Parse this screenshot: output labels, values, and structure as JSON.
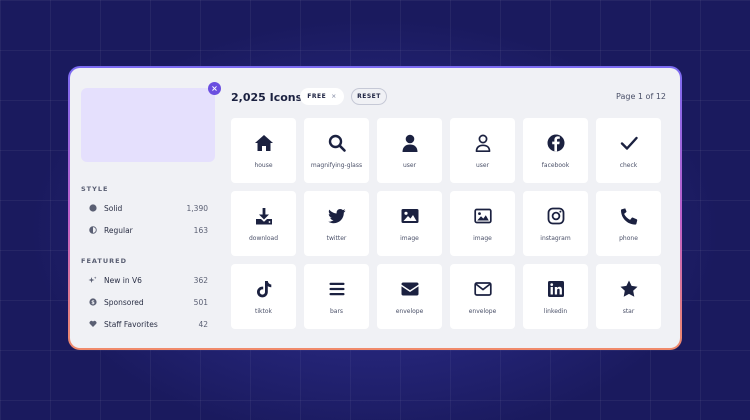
{
  "sidebar": {
    "close_label": "×",
    "style_title": "STYLE",
    "style_items": [
      {
        "label": "Solid",
        "count": "1,390",
        "icon": "solid-circle-icon"
      },
      {
        "label": "Regular",
        "count": "163",
        "icon": "half-circle-icon"
      }
    ],
    "featured_title": "FEATURED",
    "featured_items": [
      {
        "label": "New in V6",
        "count": "362",
        "icon": "sparkles-icon"
      },
      {
        "label": "Sponsored",
        "count": "501",
        "icon": "dollar-circle-icon"
      },
      {
        "label": "Staff Favorites",
        "count": "42",
        "icon": "heart-icon"
      }
    ]
  },
  "header": {
    "count_title": "2,025 Icons",
    "free_label": "FREE",
    "free_clear": "×",
    "reset_label": "RESET",
    "page_indicator": "Page 1 of 12"
  },
  "icons": [
    {
      "name": "house",
      "icon": "house-icon"
    },
    {
      "name": "magnifying-glass",
      "icon": "magnifying-glass-icon"
    },
    {
      "name": "user",
      "icon": "user-solid-icon"
    },
    {
      "name": "user",
      "icon": "user-regular-icon"
    },
    {
      "name": "facebook",
      "icon": "facebook-icon"
    },
    {
      "name": "check",
      "icon": "check-icon"
    },
    {
      "name": "download",
      "icon": "download-icon"
    },
    {
      "name": "twitter",
      "icon": "twitter-icon"
    },
    {
      "name": "image",
      "icon": "image-solid-icon"
    },
    {
      "name": "image",
      "icon": "image-regular-icon"
    },
    {
      "name": "instagram",
      "icon": "instagram-icon"
    },
    {
      "name": "phone",
      "icon": "phone-icon"
    },
    {
      "name": "tiktok",
      "icon": "tiktok-icon"
    },
    {
      "name": "bars",
      "icon": "bars-icon"
    },
    {
      "name": "envelope",
      "icon": "envelope-solid-icon"
    },
    {
      "name": "envelope",
      "icon": "envelope-regular-icon"
    },
    {
      "name": "linkedin",
      "icon": "linkedin-icon"
    },
    {
      "name": "star",
      "icon": "star-icon"
    }
  ],
  "colors": {
    "background": "#1a1a5e",
    "panel": "#f0f1f5",
    "icon": "#1b2140",
    "accent": "#6b4fe0",
    "ad_box": "#e5e0fd"
  }
}
